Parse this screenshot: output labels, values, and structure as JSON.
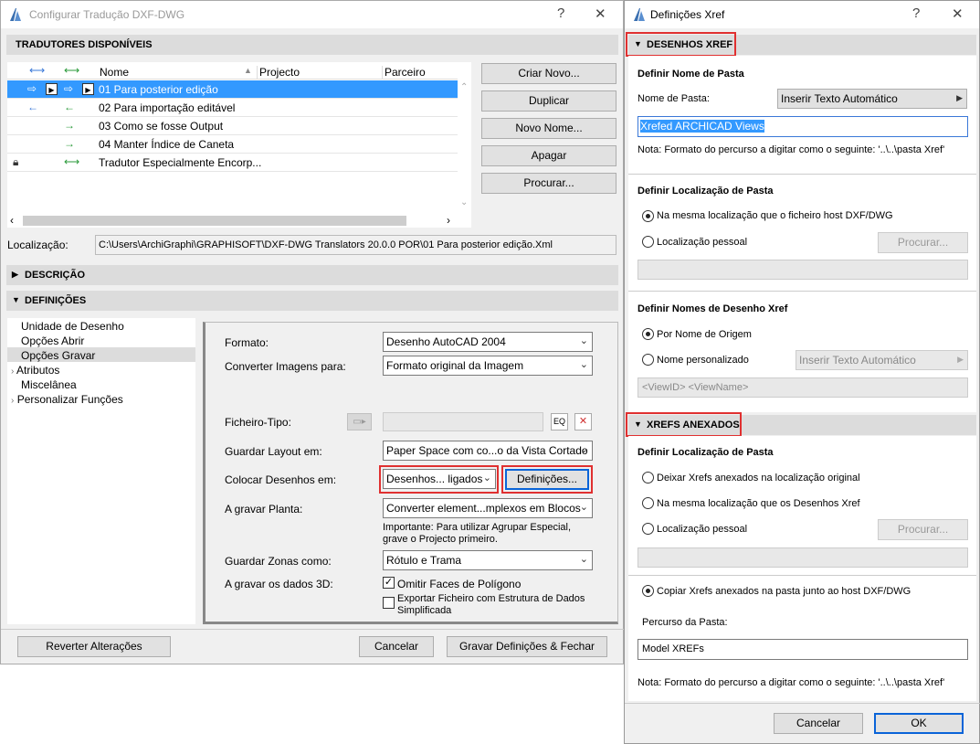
{
  "left_window": {
    "title": "Configurar Tradução DXF-DWG",
    "help_label": "?",
    "close_label": "✕",
    "section_available": "TRADUTORES DISPONÍVEIS",
    "columns": [
      "Nome",
      "Projecto",
      "Parceiro"
    ],
    "rows": [
      {
        "name": "01 Para posterior edição",
        "selected": true
      },
      {
        "name": "02 Para importação editável"
      },
      {
        "name": "03 Como se fosse Output"
      },
      {
        "name": "04 Manter Índice de Caneta"
      },
      {
        "name": "Tradutor Especialmente Encorp..."
      }
    ],
    "buttons": {
      "create": "Criar Novo...",
      "duplicate": "Duplicar",
      "rename": "Novo Nome...",
      "delete": "Apagar",
      "browse": "Procurar..."
    },
    "location_label": "Localização:",
    "location_value": "C:\\Users\\ArchiGraphi\\GRAPHISOFT\\DXF-DWG Translators 20.0.0 POR\\01 Para posterior edição.Xml",
    "section_description": "DESCRIÇÃO",
    "section_settings": "DEFINIÇÕES",
    "tree": [
      {
        "label": "Unidade de Desenho",
        "expandable": false
      },
      {
        "label": "Opções Abrir",
        "expandable": false
      },
      {
        "label": "Opções Gravar",
        "expandable": false,
        "selected": true
      },
      {
        "label": "Atributos",
        "expandable": true
      },
      {
        "label": "Miscelânea",
        "expandable": false
      },
      {
        "label": "Personalizar Funções",
        "expandable": true
      }
    ],
    "form": {
      "format_label": "Formato:",
      "format_value": "Desenho AutoCAD 2004",
      "convert_images_label": "Converter Imagens para:",
      "convert_images_value": "Formato original da Imagem",
      "template_label": "Ficheiro-Tipo:",
      "save_layout_label": "Guardar Layout em:",
      "save_layout_value": "Paper Space com co...o da Vista Cortado",
      "place_drawings_label": "Colocar Desenhos em:",
      "place_drawings_value": "Desenhos... ligados",
      "settings_button": "Definições...",
      "save_plan_label": "A gravar Planta:",
      "save_plan_value": "Converter element...mplexos em Blocos",
      "important_note": "Importante: Para utilizar Agrupar Especial, grave o Projecto primeiro.",
      "save_zones_label": "Guardar Zonas como:",
      "save_zones_value": "Rótulo e Trama",
      "save_3d_label": "A gravar os dados 3D:",
      "omit_faces_label": "Omitir Faces de Polígono",
      "omit_faces_checked": true,
      "export_simplified_label": "Exportar Ficheiro com Estrutura de Dados Simplificada",
      "export_simplified_checked": false
    },
    "footer": {
      "revert": "Reverter Alterações",
      "cancel": "Cancelar",
      "save_close": "Gravar Definições & Fechar"
    }
  },
  "right_window": {
    "title": "Definições Xref",
    "help_label": "?",
    "close_label": "✕",
    "section_xref": "DESENHOS XREF",
    "folder_name_heading": "Definir Nome de Pasta",
    "folder_name_label": "Nome de Pasta:",
    "auto_text_button": "Inserir Texto Automático",
    "folder_name_value": "Xrefed ARCHICAD Views",
    "note1": "Nota: Formato do percurso a digitar como o seguinte:   '..\\..\\pasta Xref'",
    "folder_location_heading": "Definir Localização de Pasta",
    "same_as_host": "Na mesma localização que o ficheiro host DXF/DWG",
    "personal_location": "Localização pessoal",
    "browse": "Procurar...",
    "drawing_names_heading": "Definir Nomes de Desenho Xref",
    "by_source_name": "Por Nome de Origem",
    "custom_name": "Nome personalizado",
    "auto_text_disabled": "Inserir Texto Automático",
    "name_pattern": "<ViewID> <ViewName>",
    "section_attached": "XREFS ANEXADOS",
    "attached_location_heading": "Definir Localização de Pasta",
    "leave_original": "Deixar Xrefs anexados na localização original",
    "same_as_drawings": "Na mesma localização que os Desenhos Xref",
    "personal_location2": "Localização pessoal",
    "browse2": "Procurar...",
    "copy_attached": "Copiar Xrefs anexados na pasta junto ao host DXF/DWG",
    "folder_path_label": "Percurso da Pasta:",
    "folder_path_value": "Model XREFs",
    "note2": "Nota: Formato do percurso a digitar como o seguinte:   '..\\..\\pasta Xref'",
    "cancel": "Cancelar",
    "ok": "OK"
  },
  "colors": {
    "selection": "#3399ff",
    "highlight_border": "#e03030",
    "ok_border": "#0a64d8"
  }
}
